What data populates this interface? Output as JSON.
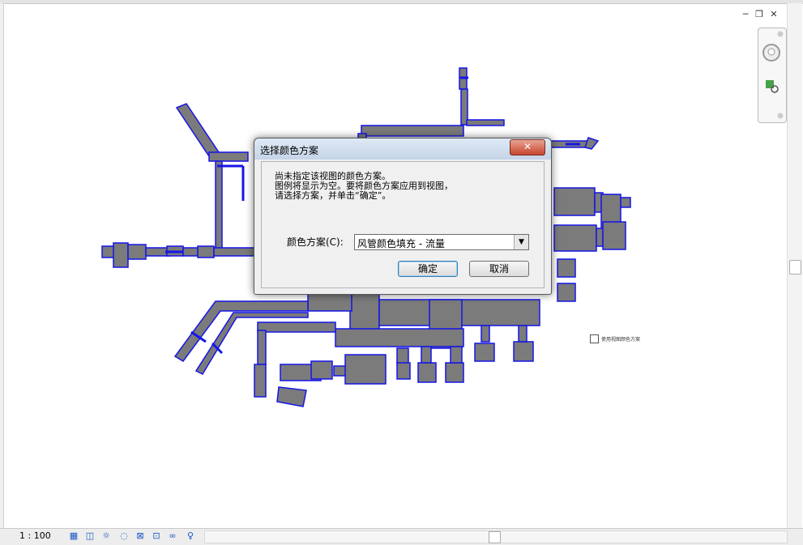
{
  "window_controls": {
    "minimize": "─",
    "restore": "❐",
    "close": "✕"
  },
  "dialog": {
    "title": "选择颜色方案",
    "message_line1": "尚未指定该视图的颜色方案。",
    "message_line2": "图例将显示为空。要将颜色方案应用到视图，",
    "message_line3": "请选择方案，并单击“确定”。",
    "scheme_label": "颜色方案(C):",
    "scheme_value": "风管颜色填充 - 流量",
    "ok_label": "确定",
    "cancel_label": "取消",
    "close_glyph": "✕"
  },
  "canvas": {
    "checkbox_label": "使用视图颜色方案"
  },
  "statusbar": {
    "scale": "1 : 100"
  },
  "colors": {
    "duct_fill": "#7b7b7b",
    "duct_edge": "#1515e8"
  }
}
